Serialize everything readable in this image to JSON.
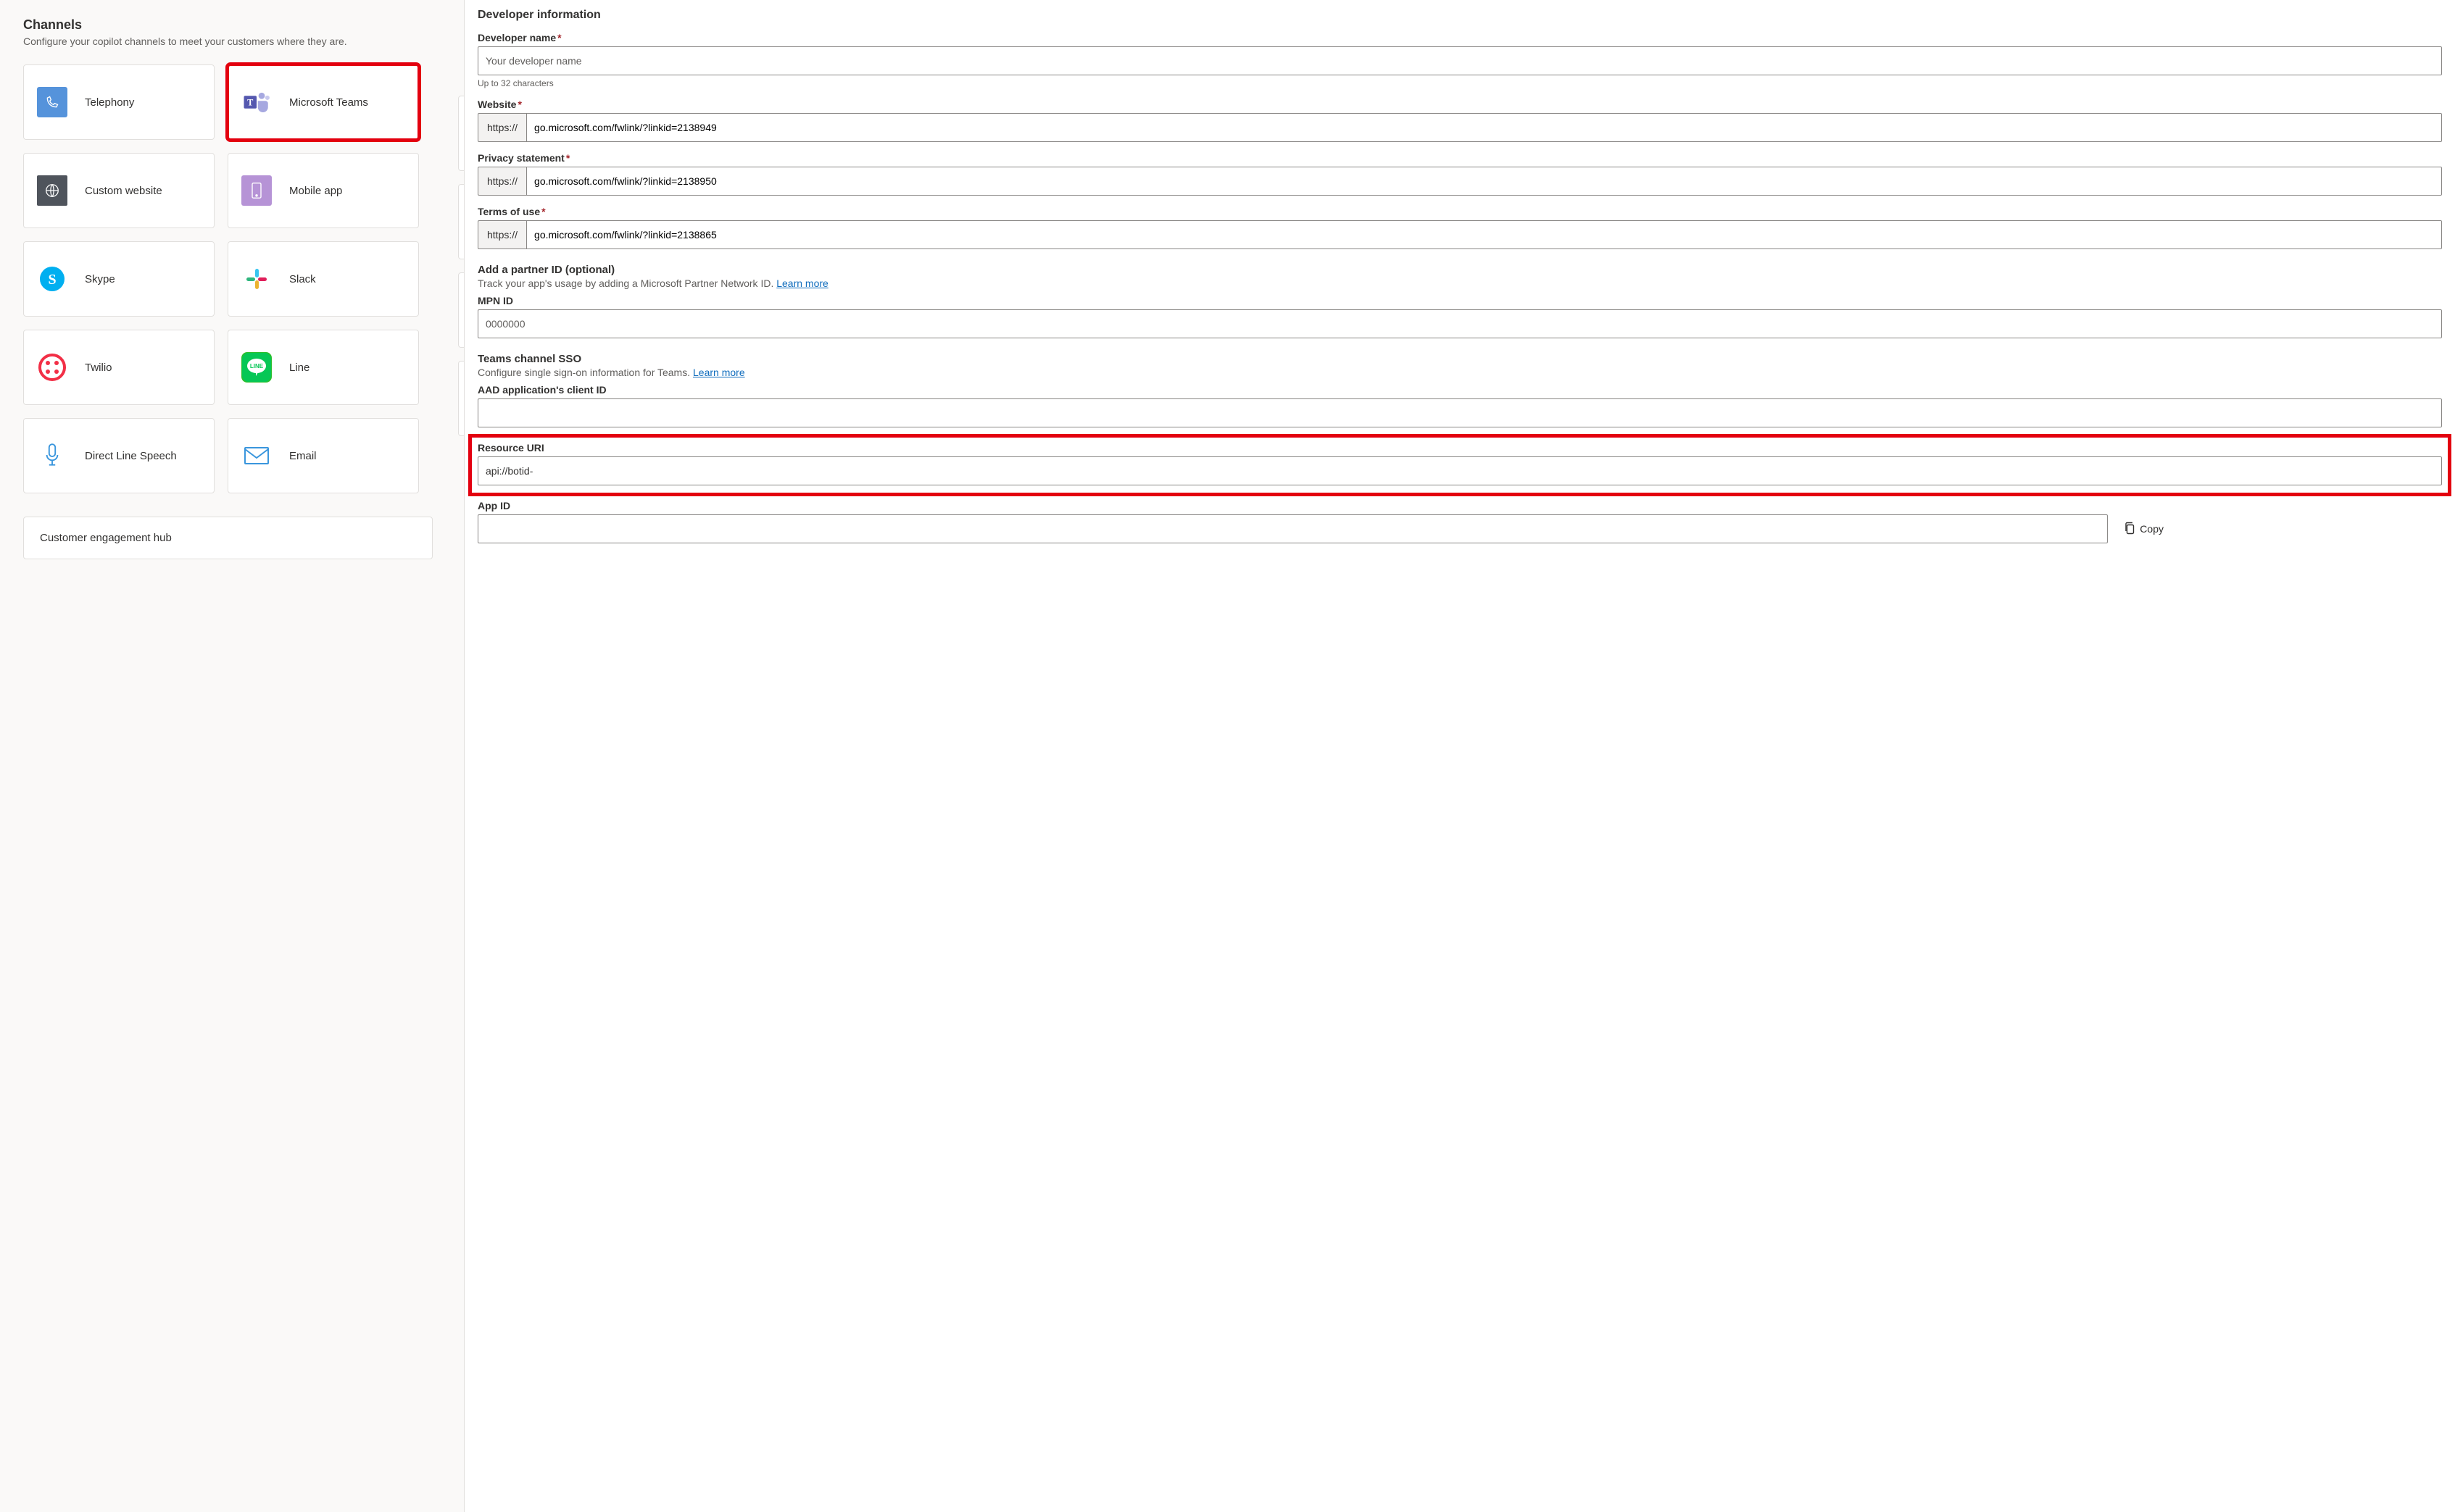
{
  "channels": {
    "title": "Channels",
    "subtitle": "Configure your copilot channels to meet your customers where they are.",
    "items": [
      {
        "label": "Telephony"
      },
      {
        "label": "Microsoft Teams"
      },
      {
        "label": "Custom website"
      },
      {
        "label": "Mobile app"
      },
      {
        "label": "Skype"
      },
      {
        "label": "Slack"
      },
      {
        "label": "Twilio"
      },
      {
        "label": "Line"
      },
      {
        "label": "Direct Line Speech"
      },
      {
        "label": "Email"
      }
    ],
    "hub_title": "Customer engagement hub"
  },
  "form": {
    "section_title": "Developer information",
    "dev_name": {
      "label": "Developer name",
      "placeholder": "Your developer name",
      "helper": "Up to 32 characters"
    },
    "website": {
      "label": "Website",
      "prefix": "https://",
      "value": "go.microsoft.com/fwlink/?linkid=2138949"
    },
    "privacy": {
      "label": "Privacy statement",
      "prefix": "https://",
      "value": "go.microsoft.com/fwlink/?linkid=2138950"
    },
    "terms": {
      "label": "Terms of use",
      "prefix": "https://",
      "value": "go.microsoft.com/fwlink/?linkid=2138865"
    },
    "partner": {
      "heading": "Add a partner ID (optional)",
      "desc_pre": "Track your app's usage by adding a Microsoft Partner Network ID. ",
      "learn": "Learn more",
      "mpn_label": "MPN ID",
      "mpn_placeholder": "0000000"
    },
    "sso": {
      "heading": "Teams channel SSO",
      "desc_pre": "Configure single sign-on information for Teams. ",
      "learn": "Learn more",
      "client_label": "AAD application's client ID",
      "resource_label": "Resource URI",
      "resource_value": "api://botid-",
      "appid_label": "App ID",
      "copy": "Copy"
    }
  }
}
